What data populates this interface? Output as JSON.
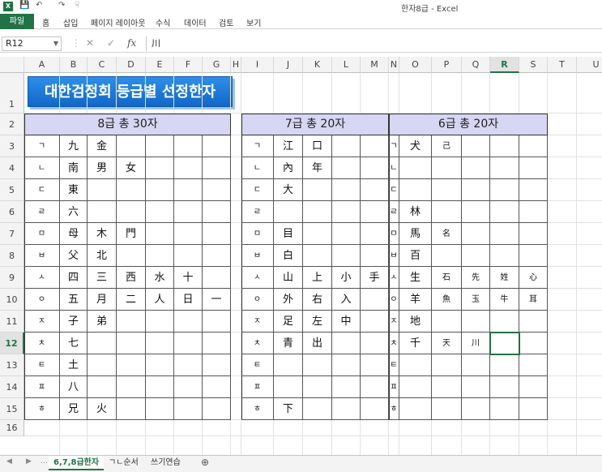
{
  "window": {
    "title": "한자8급 - Excel"
  },
  "ribbon": {
    "tabs": [
      "파일",
      "홈",
      "삽입",
      "페이지 레이아웃",
      "수식",
      "데이터",
      "검토",
      "보기"
    ]
  },
  "formula_bar": {
    "name_box": "R12",
    "formula": "川"
  },
  "columns": [
    "A",
    "B",
    "C",
    "D",
    "E",
    "F",
    "G",
    "H",
    "I",
    "J",
    "K",
    "L",
    "M",
    "N",
    "O",
    "P",
    "Q",
    "R",
    "S",
    "T",
    "U"
  ],
  "rows": [
    "1",
    "2",
    "3",
    "4",
    "5",
    "6",
    "7",
    "8",
    "9",
    "10",
    "11",
    "12",
    "13",
    "14",
    "15",
    "16"
  ],
  "selected": {
    "column": "R",
    "row": "12"
  },
  "banner": "대한검정회 등급별 선정한자",
  "tables": [
    {
      "header": "8급 총 30자",
      "jamo": [
        "ㄱ",
        "ㄴ",
        "ㄷ",
        "ㄹ",
        "ㅁ",
        "ㅂ",
        "ㅅ",
        "ㅇ",
        "ㅈ",
        "ㅊ",
        "ㅌ",
        "ㅍ",
        "ㅎ"
      ],
      "chars": [
        [
          "九",
          "金",
          "",
          "",
          "",
          ""
        ],
        [
          "南",
          "男",
          "女",
          "",
          "",
          ""
        ],
        [
          "東",
          "",
          "",
          "",
          "",
          ""
        ],
        [
          "六",
          "",
          "",
          "",
          "",
          ""
        ],
        [
          "母",
          "木",
          "門",
          "",
          "",
          ""
        ],
        [
          "父",
          "北",
          "",
          "",
          "",
          ""
        ],
        [
          "四",
          "三",
          "西",
          "水",
          "十",
          ""
        ],
        [
          "五",
          "月",
          "二",
          "人",
          "日",
          "一"
        ],
        [
          "子",
          "弟",
          "",
          "",
          "",
          ""
        ],
        [
          "七",
          "",
          "",
          "",
          "",
          ""
        ],
        [
          "土",
          "",
          "",
          "",
          "",
          ""
        ],
        [
          "八",
          "",
          "",
          "",
          "",
          ""
        ],
        [
          "兄",
          "火",
          "",
          "",
          "",
          ""
        ]
      ]
    },
    {
      "header": "7급 총 20자",
      "jamo": [
        "ㄱ",
        "ㄴ",
        "ㄷ",
        "ㄹ",
        "ㅁ",
        "ㅂ",
        "ㅅ",
        "ㅇ",
        "ㅈ",
        "ㅊ",
        "ㅌ",
        "ㅍ",
        "ㅎ"
      ],
      "chars": [
        [
          "江",
          "口",
          "",
          ""
        ],
        [
          "內",
          "年",
          "",
          ""
        ],
        [
          "大",
          "",
          "",
          ""
        ],
        [
          "",
          "",
          "",
          ""
        ],
        [
          "目",
          "",
          "",
          ""
        ],
        [
          "白",
          "",
          "",
          ""
        ],
        [
          "山",
          "上",
          "小",
          "手"
        ],
        [
          "外",
          "右",
          "入",
          ""
        ],
        [
          "足",
          "左",
          "中",
          ""
        ],
        [
          "青",
          "出",
          "",
          ""
        ],
        [
          "",
          "",
          "",
          ""
        ],
        [
          "",
          "",
          "",
          ""
        ],
        [
          "下",
          "",
          "",
          ""
        ]
      ]
    },
    {
      "header": "6급 총 20자",
      "jamo": [
        "ㄱ",
        "ㄴ",
        "ㄷ",
        "ㄹ",
        "ㅁ",
        "ㅂ",
        "ㅅ",
        "ㅇ",
        "ㅈ",
        "ㅊ",
        "ㅌ",
        "ㅍ",
        "ㅎ"
      ],
      "chars": [
        [
          "犬",
          "己",
          "",
          "",
          ""
        ],
        [
          "",
          "",
          "",
          "",
          ""
        ],
        [
          "",
          "",
          "",
          "",
          ""
        ],
        [
          "林",
          "",
          "",
          "",
          ""
        ],
        [
          "馬",
          "名",
          "",
          "",
          ""
        ],
        [
          "百",
          "",
          "",
          "",
          ""
        ],
        [
          "生",
          "石",
          "先",
          "姓",
          "心"
        ],
        [
          "羊",
          "魚",
          "玉",
          "牛",
          "耳"
        ],
        [
          "地",
          "",
          "",
          "",
          ""
        ],
        [
          "千",
          "天",
          "川",
          "",
          ""
        ],
        [
          "",
          "",
          "",
          "",
          ""
        ],
        [
          "",
          "",
          "",
          "",
          ""
        ],
        [
          "",
          "",
          "",
          "",
          ""
        ]
      ]
    }
  ],
  "sheets": [
    "6,7,8급한자",
    "ㄱㄴ순서",
    "쓰기연습"
  ],
  "active_sheet": 0
}
